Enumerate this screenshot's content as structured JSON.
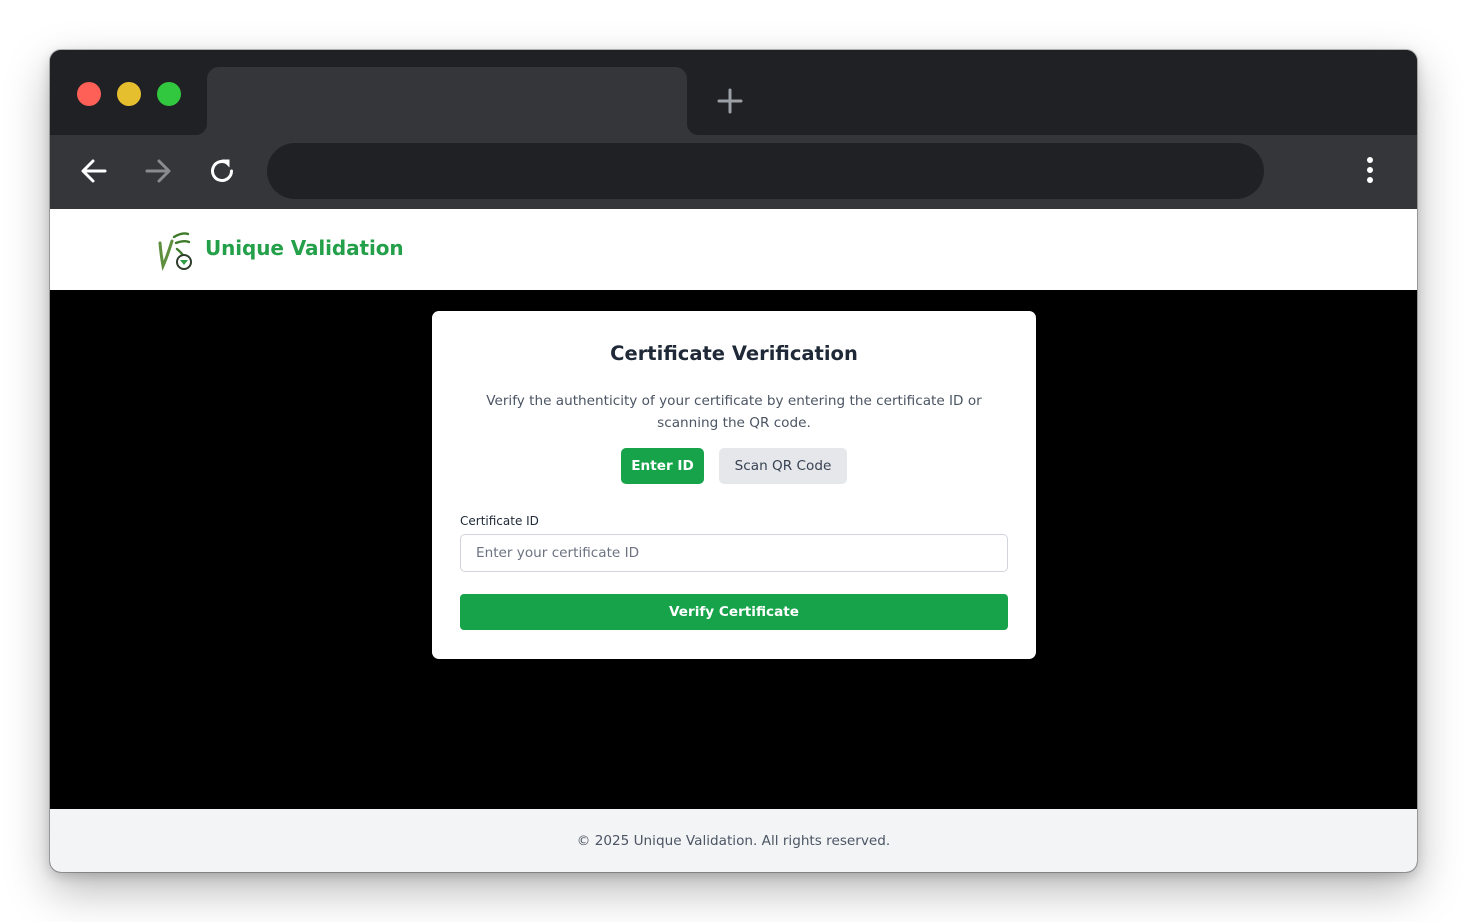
{
  "browser": {
    "tab_title": "",
    "address": "",
    "new_tab_icon": "plus-icon",
    "back_icon": "arrow-left-icon",
    "forward_icon": "arrow-right-icon",
    "reload_icon": "reload-icon",
    "menu_icon": "kebab-menu-icon",
    "colors": {
      "frame": "#202124",
      "toolbar": "#35363a",
      "close": "#fe5f57",
      "minimize": "#e6bf2e",
      "maximize": "#31c73f"
    }
  },
  "header": {
    "brand": "Unique Validation",
    "logo_icon": "unique-validation-logo",
    "brand_color": "#25a04a"
  },
  "card": {
    "title": "Certificate Verification",
    "description": "Verify the authenticity of your certificate by entering the certificate ID or scanning the QR code.",
    "modes": {
      "enter_id": "Enter ID",
      "scan_qr": "Scan QR Code",
      "selected": "Enter ID"
    },
    "field": {
      "label": "Certificate ID",
      "placeholder": "Enter your certificate ID",
      "value": ""
    },
    "submit": "Verify Certificate",
    "accent": "#16a34a"
  },
  "footer": {
    "text": "© 2025 Unique Validation. All rights reserved."
  }
}
